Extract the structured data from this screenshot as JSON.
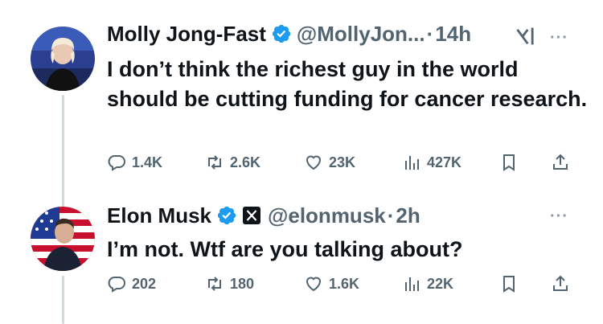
{
  "tweets": [
    {
      "name": "Molly Jong-Fast",
      "handle": "@MollyJon...",
      "separator": "·",
      "time": "14h",
      "text": "I don’t think the richest guy in the world should be cutting funding for cancer research.",
      "replies": "1.4K",
      "retweets": "2.6K",
      "likes": "23K",
      "views": "427K",
      "more": "···"
    },
    {
      "name": "Elon Musk",
      "handle": "@elonmusk",
      "separator": "·",
      "time": "2h",
      "text": "I’m not. Wtf are you talking about?",
      "replies": "202",
      "retweets": "180",
      "likes": "1.6K",
      "views": "22K",
      "more": "···"
    }
  ],
  "colors": {
    "verified": "#1d9bf0",
    "text": "#0f1419",
    "secondary": "#536471",
    "thread_line": "#cfd9de"
  },
  "icons": [
    "reply-icon",
    "retweet-icon",
    "like-icon",
    "views-icon",
    "bookmark-icon",
    "share-icon",
    "verified-icon",
    "x-badge-icon",
    "grok-icon",
    "more-icon"
  ]
}
